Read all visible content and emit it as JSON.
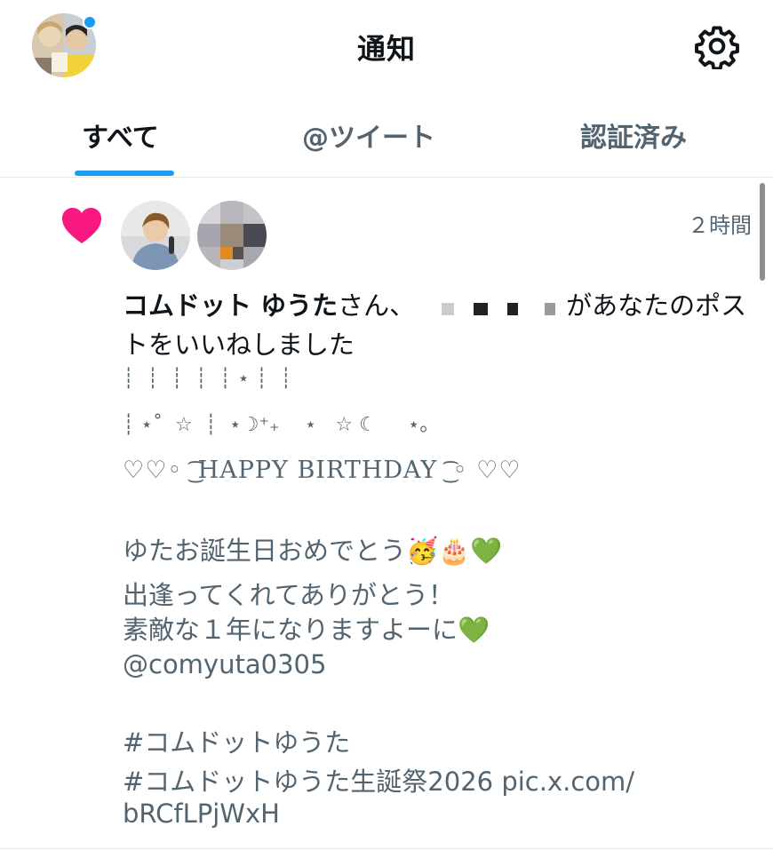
{
  "header": {
    "title": "通知",
    "account_icon": "profile-photo",
    "settings_icon": "gear-icon",
    "notification_dot_color": "#1d9bf0"
  },
  "tabs": [
    {
      "label": "すべて",
      "active": true
    },
    {
      "label": "@ツイート",
      "active": false
    },
    {
      "label": "認証済み",
      "active": false
    }
  ],
  "notification": {
    "type_icon": "heart-icon",
    "type_icon_color": "#f91880",
    "time": "２時間",
    "user_name": "コムドット ゆうた",
    "summary_pre": "さん、",
    "summary_post": "があなたのポストをいいねしました",
    "deco_line_1": "┊  ┊  ┊  ┊  ┊ ⋆ ┊  ┊",
    "deco_line_2": "┊ ⋆˚  ☆  ┊  ⋆☽︎⁺₊    ⋆   ☆ ☾     ⋆｡",
    "birthday_line": "♡♡◦ ͜͡ HAPPY BIRTHDAY ͜͡ ◦ ♡♡",
    "line_1": "ゆたお誕生日おめでとう🥳🎂💚",
    "line_2": "出逢ってくれてありがとう！",
    "line_3": "素敵な１年になりますよーに💚",
    "line_4": "@comyuta0305",
    "line_5": "#コムドットゆうた",
    "line_6": "#コムドットゆうた生誕祭2026 pic.x.com/",
    "line_7": "bRCfLPjWxH"
  }
}
